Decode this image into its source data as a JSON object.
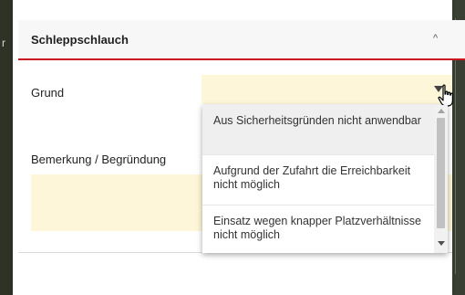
{
  "background": {
    "left_letter": "r"
  },
  "panel": {
    "title": "Schleppschlauch",
    "collapse_icon": "chevron-up-icon",
    "accent_color": "#c9151e"
  },
  "form": {
    "grund_label": "Grund",
    "grund_value": "",
    "bemerkung_label": "Bemerkung / Begründung",
    "bemerkung_value": "",
    "field_bg_color": "#fdf6d8"
  },
  "dropdown": {
    "options": [
      "Aus Sicherheitsgründen nicht anwendbar",
      "Aufgrund der Zufahrt die Erreichbarkeit nicht möglich",
      "Einsatz wegen knapper Platzverhältnisse nicht möglich"
    ],
    "highlighted_index": 0
  }
}
